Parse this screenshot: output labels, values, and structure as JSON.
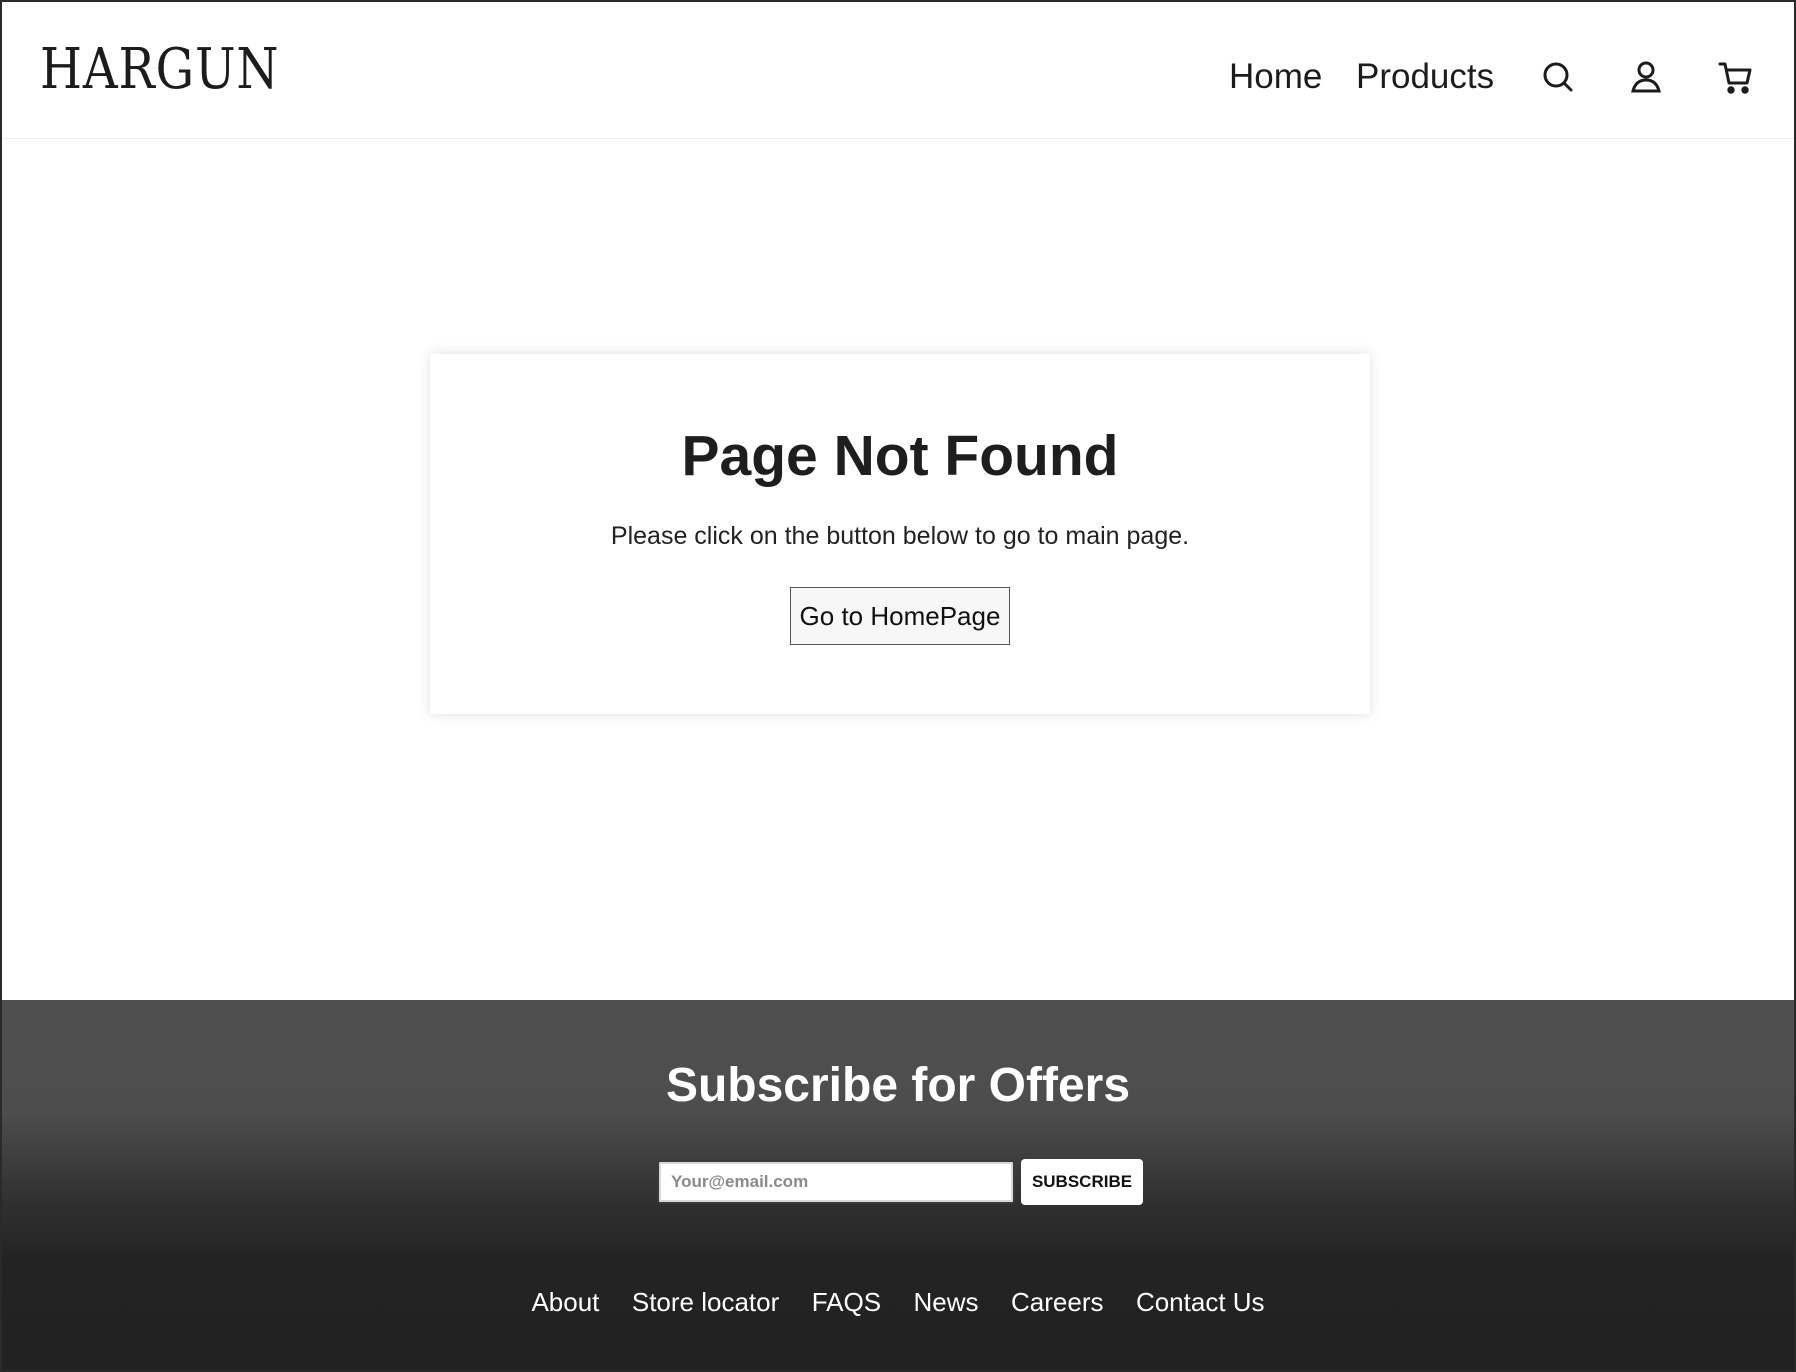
{
  "header": {
    "logo": "HARGUN",
    "nav": {
      "home": "Home",
      "products": "Products"
    },
    "icons": [
      "search-icon",
      "account-icon",
      "cart-icon"
    ]
  },
  "main": {
    "title": "Page Not Found",
    "message": "Please click on the button below to go to main page.",
    "button_label": "Go to HomePage"
  },
  "footer": {
    "title": "Subscribe for Offers",
    "email_placeholder": "Your@email.com",
    "email_value": "",
    "subscribe_label": "SUBSCRIBE",
    "links": [
      "About",
      "Store locator",
      "FAQS",
      "News",
      "Careers",
      "Contact Us"
    ]
  },
  "colors": {
    "text": "#1a1a1a",
    "footer_top": "#4f4f4f",
    "footer_bottom": "#222222",
    "white": "#ffffff"
  }
}
